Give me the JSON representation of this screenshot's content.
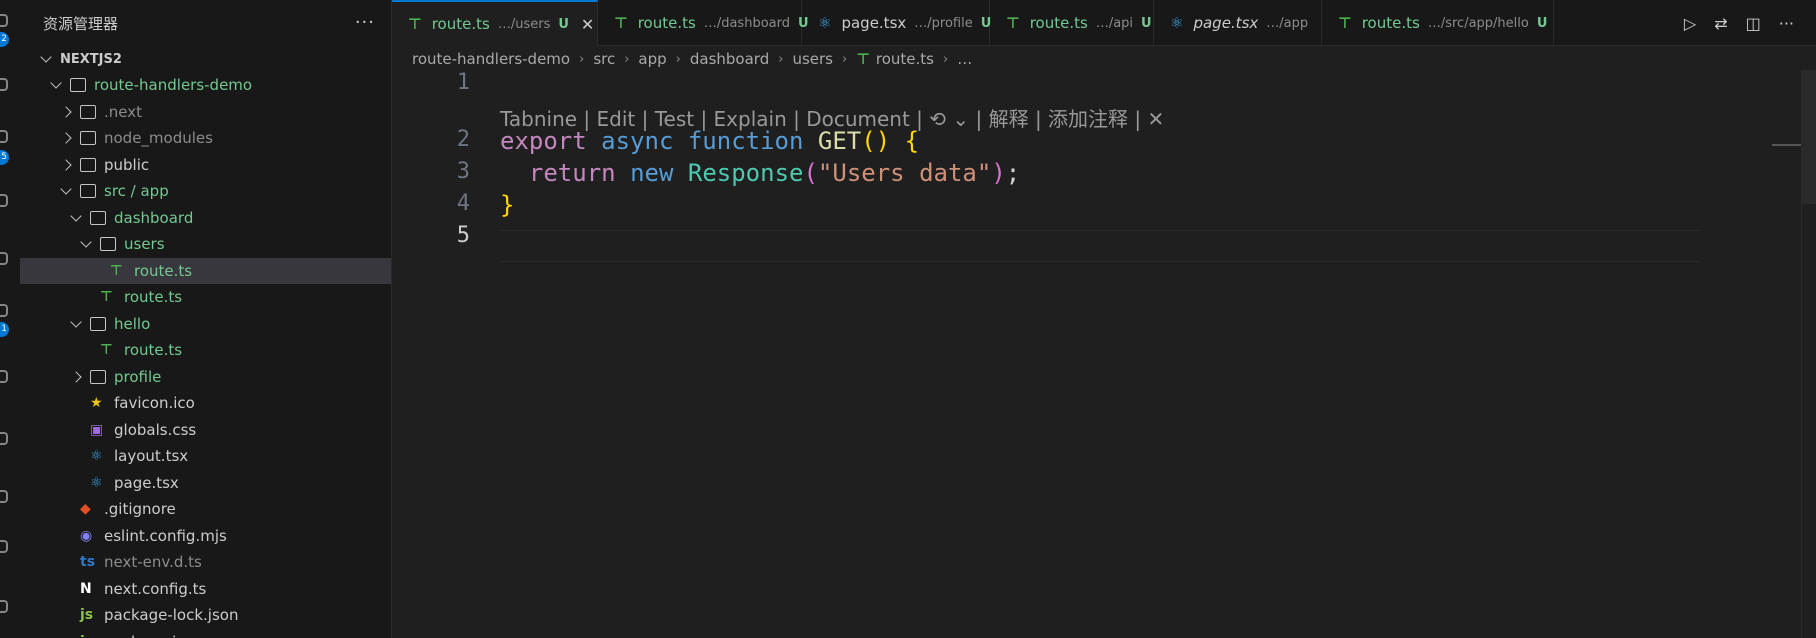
{
  "activity_bar": {
    "badges": [
      "2",
      "5",
      "1"
    ]
  },
  "explorer": {
    "title": "资源管理器",
    "more_label": "···",
    "root": "NEXTJS2",
    "tree": [
      {
        "name": "route-handlers-demo",
        "kind": "folder-open",
        "depth": 1,
        "color": "green",
        "status": "dot"
      },
      {
        "name": ".next",
        "kind": "folder",
        "depth": 2,
        "color": "gray",
        "status": ""
      },
      {
        "name": "node_modules",
        "kind": "folder",
        "depth": 2,
        "color": "gray",
        "status": ""
      },
      {
        "name": "public",
        "kind": "folder",
        "depth": 2,
        "color": "white",
        "status": ""
      },
      {
        "name": "src / app",
        "kind": "folder-open",
        "depth": 2,
        "color": "green",
        "status": "dot"
      },
      {
        "name": "dashboard",
        "kind": "folder-open",
        "depth": 3,
        "color": "green",
        "status": "dot"
      },
      {
        "name": "users",
        "kind": "folder-open",
        "depth": 4,
        "color": "green",
        "status": "dot"
      },
      {
        "name": "route.ts",
        "kind": "ts-file",
        "depth": 5,
        "color": "green",
        "status": "U",
        "selected": true
      },
      {
        "name": "route.ts",
        "kind": "ts-file",
        "depth": 4,
        "color": "green",
        "status": "U"
      },
      {
        "name": "hello",
        "kind": "folder-open",
        "depth": 3,
        "color": "green",
        "status": "dot"
      },
      {
        "name": "route.ts",
        "kind": "ts-file",
        "depth": 4,
        "color": "green",
        "status": "U"
      },
      {
        "name": "profile",
        "kind": "folder",
        "depth": 3,
        "color": "green",
        "status": "dot"
      },
      {
        "name": "favicon.ico",
        "kind": "star-file",
        "depth": 3,
        "color": "white",
        "status": ""
      },
      {
        "name": "globals.css",
        "kind": "css-file",
        "depth": 3,
        "color": "white",
        "status": ""
      },
      {
        "name": "layout.tsx",
        "kind": "react-file",
        "depth": 3,
        "color": "white",
        "status": ""
      },
      {
        "name": "page.tsx",
        "kind": "react-file",
        "depth": 3,
        "color": "white",
        "status": ""
      },
      {
        "name": ".gitignore",
        "kind": "git-file",
        "depth": 2,
        "color": "white",
        "status": ""
      },
      {
        "name": "eslint.config.mjs",
        "kind": "eslint-file",
        "depth": 2,
        "color": "white",
        "status": ""
      },
      {
        "name": "next-env.d.ts",
        "kind": "ts-def-file",
        "depth": 2,
        "color": "gray",
        "status": ""
      },
      {
        "name": "next.config.ts",
        "kind": "next-file",
        "depth": 2,
        "color": "white",
        "status": ""
      },
      {
        "name": "package-lock.json",
        "kind": "json-file",
        "depth": 2,
        "color": "white",
        "status": ""
      },
      {
        "name": "package.json",
        "kind": "json-file",
        "depth": 2,
        "color": "white",
        "status": ""
      }
    ]
  },
  "tabs": [
    {
      "name": "route.ts",
      "desc": "…/users",
      "mark": "U",
      "icon": "ts",
      "active": true,
      "close": "✕",
      "italic": false
    },
    {
      "name": "route.ts",
      "desc": "…/dashboard",
      "mark": "U",
      "icon": "ts",
      "active": false,
      "italic": false
    },
    {
      "name": "page.tsx",
      "desc": "…/profile",
      "mark": "U",
      "icon": "react",
      "active": false,
      "italic": false
    },
    {
      "name": "route.ts",
      "desc": "…/api",
      "mark": "U",
      "icon": "ts",
      "active": false,
      "italic": false
    },
    {
      "name": "page.tsx",
      "desc": "…/app",
      "mark": "",
      "icon": "react",
      "active": false,
      "italic": true
    },
    {
      "name": "route.ts",
      "desc": "…/src/app/hello",
      "mark": "U",
      "icon": "ts",
      "active": false,
      "italic": false,
      "dirty": true
    }
  ],
  "breadcrumb": [
    "route-handlers-demo",
    "src",
    "app",
    "dashboard",
    "users",
    "route.ts",
    "…"
  ],
  "codelens": "Tabnine | Edit | Test | Explain | Document | ⟲ ⌄ | 解释 | 添加注释 | ✕",
  "code_lines": [
    {
      "num": "1",
      "html_tokens": []
    },
    {
      "num": "2",
      "html_tokens": [
        [
          "kw",
          "export"
        ],
        [
          "plain",
          " "
        ],
        [
          "kw2",
          "async"
        ],
        [
          "plain",
          " "
        ],
        [
          "kw2",
          "function"
        ],
        [
          "plain",
          " "
        ],
        [
          "fn",
          "GET"
        ],
        [
          "p1",
          "()"
        ],
        [
          "plain",
          " "
        ],
        [
          "p1",
          "{"
        ]
      ]
    },
    {
      "num": "3",
      "html_tokens": [
        [
          "plain",
          "  "
        ],
        [
          "kw",
          "return"
        ],
        [
          "plain",
          " "
        ],
        [
          "kw2",
          "new"
        ],
        [
          "plain",
          " "
        ],
        [
          "cls",
          "Response"
        ],
        [
          "p2",
          "("
        ],
        [
          "str",
          "\"Users data\""
        ],
        [
          "p2",
          ")"
        ],
        [
          "plain",
          ";"
        ]
      ]
    },
    {
      "num": "4",
      "html_tokens": [
        [
          "p1",
          "}"
        ]
      ]
    },
    {
      "num": "5",
      "html_tokens": []
    }
  ],
  "colors": {
    "accent": "#0078d4",
    "untracked": "#73c991"
  }
}
